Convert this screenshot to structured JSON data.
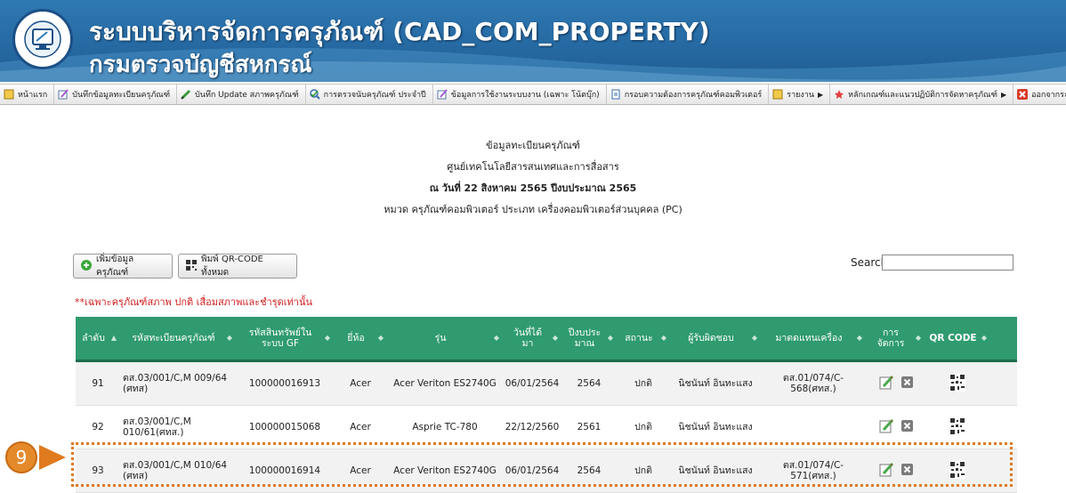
{
  "header": {
    "title_line1": "ระบบบริหารจัดการครุภัณฑ์ (CAD_COM_PROPERTY)",
    "title_line2": "กรมตรวจบัญชีสหกรณ์",
    "logo_icon": "monitor-logo-icon"
  },
  "menu": {
    "items": [
      {
        "label": "หน้าแรก",
        "icon": "home-icon"
      },
      {
        "label": "บันทึกข้อมูลทะเบียนครุภัณฑ์",
        "icon": "edit-icon"
      },
      {
        "label": "บันทึก Update สภาพครุภัณฑ์",
        "icon": "pencil-icon"
      },
      {
        "label": "การตรวจนับครุภัณฑ์ ประจำปี",
        "icon": "check-icon"
      },
      {
        "label": "ข้อมูลการใช้งานระบบงาน (เฉพาะ โน้ตบุ๊ก)",
        "icon": "edit-icon"
      },
      {
        "label": "กรอบความต้องการครุภัณฑ์คอมพิวเตอร์",
        "icon": "document-icon"
      },
      {
        "label": "รายงาน",
        "icon": "report-icon"
      },
      {
        "label": "หลักเกณฑ์และแนวปฏิบัติการจัดหาครุภัณฑ์",
        "icon": "star-icon"
      },
      {
        "label": "ออกจากระบบ",
        "icon": "close-icon"
      }
    ]
  },
  "report": {
    "line1": "ข้อมูลทะเบียนครุภัณฑ์",
    "line2": "ศูนย์เทคโนโลยีสารสนเทศและการสื่อสาร",
    "line3": "ณ วันที่ 22 สิงหาคม 2565  ปีงบประมาณ 2565",
    "line4": "หมวด ครุภัณฑ์คอมพิวเตอร์  ประเภท เครื่องคอมพิวเตอร์ส่วนบุคคล (PC)"
  },
  "toolbar": {
    "add_label": "เพิ่มข้อมูลครุภัณฑ์",
    "qr_label": "พิมพ์ QR-CODE ทั้งหมด",
    "search_label": "Search:",
    "search_value": ""
  },
  "note": "**เฉพาะครุภัณฑ์สภาพ ปกติ เสื่อมสภาพและชำรุดเท่านั้น",
  "table": {
    "headers": [
      "ลำดับ",
      "รหัสทะเบียนครุภัณฑ์",
      "รหัสสินทรัพย์ใน ระบบ GF",
      "ยี่ห้อ",
      "รุ่น",
      "วันที่ได้ มา",
      "ปีงบประ มาณ",
      "สถานะ",
      "ผู้รับผิดชอบ",
      "มาตดแทนเครื่อง",
      "การ จัดการ",
      "QR CODE"
    ],
    "rows": [
      {
        "no": "91",
        "code": "ตส.03/001/C,M 009/64 (ศทส)",
        "gf": "100000016913",
        "brand": "Acer",
        "model": "Acer Veriton ES2740G",
        "date": "06/01/2564",
        "year": "2564",
        "status": "ปกติ",
        "owner": "นิชนันท์ อินทะแสง",
        "replace": "ตส.01/074/C-568(ศทส.)"
      },
      {
        "no": "92",
        "code": "ตส.03/001/C,M 010/61(ศทส.)",
        "gf": "100000015068",
        "brand": "Acer",
        "model": "Asprie TC-780",
        "date": "22/12/2560",
        "year": "2561",
        "status": "ปกติ",
        "owner": "นิชนันท์ อินทะแสง",
        "replace": ""
      },
      {
        "no": "93",
        "code": "ตส.03/001/C,M 010/64 (ศทส)",
        "gf": "100000016914",
        "brand": "Acer",
        "model": "Acer Veriton ES2740G",
        "date": "06/01/2564",
        "year": "2564",
        "status": "ปกติ",
        "owner": "นิชนันท์ อินทะแสง",
        "replace": "ตส.01/074/C-571(ศทส.)"
      }
    ]
  },
  "callout": {
    "number": "9"
  },
  "colors": {
    "header_bg": "#2f79b3",
    "table_header": "#2f9b6e",
    "highlight": "#e07a1f",
    "note": "#d21c1c"
  }
}
